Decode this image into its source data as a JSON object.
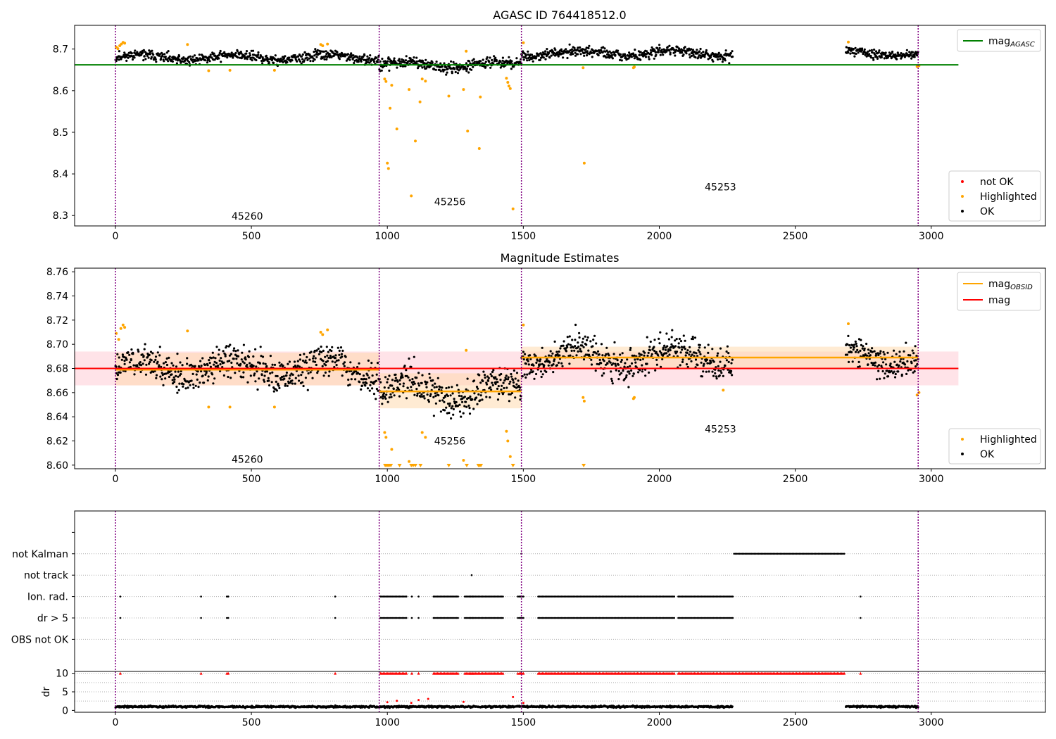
{
  "figure": {
    "background": "#ffffff",
    "obs_boundaries_x": [
      0,
      970,
      1493,
      2952
    ],
    "colors": {
      "ok": "#000000",
      "highlighted": "#ffa500",
      "not_ok": "#ff0000",
      "mag_agasc": "#008000",
      "mag_obsid": "#ffa500",
      "mag": "#ff0000",
      "mag_band": "#ffc0cb",
      "obsid_band": "#ffd8a8",
      "boundary": "#800080",
      "grid": "#b0b0b0"
    }
  },
  "chart_data": [
    {
      "type": "scatter",
      "title": "AGASC ID 764418512.0",
      "xlim": [
        -150,
        3420
      ],
      "ylim": [
        8.275,
        8.757
      ],
      "xticks": [
        0,
        500,
        1000,
        1500,
        2000,
        2500,
        3000
      ],
      "yticks": [
        8.3,
        8.4,
        8.5,
        8.6,
        8.7
      ],
      "ytick_labels": [
        "8.3",
        "8.4",
        "8.5",
        "8.6",
        "8.7"
      ],
      "legend_lines": [
        {
          "label_main": "mag",
          "label_sub": "AGASC",
          "color": "#008000"
        }
      ],
      "legend_points": [
        {
          "label": "not OK",
          "color": "#ff0000"
        },
        {
          "label": "Highlighted",
          "color": "#ffa500"
        },
        {
          "label": "OK",
          "color": "#000000"
        }
      ],
      "hlines": [
        {
          "y": 8.662,
          "x_range": [
            -150,
            3100
          ],
          "color": "#008000"
        }
      ],
      "obs_labels": [
        {
          "text": "45260",
          "x": 485,
          "y": 8.29
        },
        {
          "text": "45256",
          "x": 1230,
          "y": 8.325
        },
        {
          "text": "45253",
          "x": 2225,
          "y": 8.36
        }
      ],
      "ok_segments": [
        {
          "x": [
            0,
            970
          ],
          "level": 8.68,
          "spread": 0.028
        },
        {
          "x": [
            970,
            1493
          ],
          "level": 8.662,
          "spread": 0.03
        },
        {
          "x": [
            1493,
            2270
          ],
          "level": 8.69,
          "spread": 0.028
        },
        {
          "x": [
            2685,
            2952
          ],
          "level": 8.69,
          "spread": 0.026
        }
      ],
      "highlighted_points": [
        [
          3,
          8.705
        ],
        [
          9,
          8.701
        ],
        [
          16,
          8.708
        ],
        [
          22,
          8.712
        ],
        [
          28,
          8.716
        ],
        [
          34,
          8.714
        ],
        [
          265,
          8.711
        ],
        [
          343,
          8.648
        ],
        [
          421,
          8.649
        ],
        [
          585,
          8.649
        ],
        [
          755,
          8.711
        ],
        [
          762,
          8.708
        ],
        [
          780,
          8.712
        ],
        [
          990,
          8.628
        ],
        [
          995,
          8.622
        ],
        [
          1000,
          8.426
        ],
        [
          1004,
          8.413
        ],
        [
          1010,
          8.558
        ],
        [
          1016,
          8.613
        ],
        [
          1035,
          8.508
        ],
        [
          1080,
          8.603
        ],
        [
          1088,
          8.347
        ],
        [
          1103,
          8.479
        ],
        [
          1120,
          8.573
        ],
        [
          1128,
          8.628
        ],
        [
          1140,
          8.623
        ],
        [
          1226,
          8.587
        ],
        [
          1280,
          8.603
        ],
        [
          1290,
          8.695
        ],
        [
          1295,
          8.503
        ],
        [
          1338,
          8.461
        ],
        [
          1342,
          8.585
        ],
        [
          1438,
          8.63
        ],
        [
          1443,
          8.62
        ],
        [
          1447,
          8.611
        ],
        [
          1452,
          8.605
        ],
        [
          1462,
          8.316
        ],
        [
          1500,
          8.715
        ],
        [
          1720,
          8.655
        ],
        [
          1724,
          8.426
        ],
        [
          1905,
          8.655
        ],
        [
          1908,
          8.657
        ],
        [
          2695,
          8.717
        ],
        [
          2948,
          8.658
        ],
        [
          2955,
          8.66
        ]
      ]
    },
    {
      "type": "scatter",
      "title": "Magnitude Estimates",
      "xlim": [
        -150,
        3420
      ],
      "ylim": [
        8.597,
        8.763
      ],
      "xticks": [
        0,
        500,
        1000,
        1500,
        2000,
        2500,
        3000
      ],
      "yticks": [
        8.6,
        8.62,
        8.64,
        8.66,
        8.68,
        8.7,
        8.72,
        8.74,
        8.76
      ],
      "ytick_labels": [
        "8.60",
        "8.62",
        "8.64",
        "8.66",
        "8.68",
        "8.70",
        "8.72",
        "8.74",
        "8.76"
      ],
      "legend_lines": [
        {
          "label_main": "mag",
          "label_sub": "OBSID",
          "color": "#ffa500"
        },
        {
          "label_main": "mag",
          "label_sub": "",
          "color": "#ff0000"
        }
      ],
      "legend_points": [
        {
          "label": "Highlighted",
          "color": "#ffa500"
        },
        {
          "label": "OK",
          "color": "#000000"
        }
      ],
      "mag": {
        "value": 8.68,
        "band": [
          8.666,
          8.694
        ],
        "x_range": [
          -150,
          3100
        ]
      },
      "obsid_mags": [
        {
          "x": [
            0,
            970
          ],
          "value": 8.679,
          "band": [
            8.666,
            8.693
          ]
        },
        {
          "x": [
            970,
            1493
          ],
          "value": 8.661,
          "band": [
            8.647,
            8.676
          ]
        },
        {
          "x": [
            1493,
            2952
          ],
          "value": 8.689,
          "band": [
            8.68,
            8.698
          ]
        }
      ],
      "obs_labels": [
        {
          "text": "45260",
          "x": 485,
          "y": 8.602
        },
        {
          "text": "45256",
          "x": 1230,
          "y": 8.617
        },
        {
          "text": "45253",
          "x": 2225,
          "y": 8.627
        }
      ],
      "ok_segments": [
        {
          "x": [
            0,
            970
          ],
          "level": 8.68,
          "spread": 0.032
        },
        {
          "x": [
            970,
            1493
          ],
          "level": 8.661,
          "spread": 0.034
        },
        {
          "x": [
            1493,
            2270
          ],
          "level": 8.69,
          "spread": 0.032
        },
        {
          "x": [
            2685,
            2952
          ],
          "level": 8.69,
          "spread": 0.03
        }
      ],
      "highlighted_points": [
        [
          3,
          8.709
        ],
        [
          12,
          8.704
        ],
        [
          20,
          8.713
        ],
        [
          28,
          8.716
        ],
        [
          34,
          8.714
        ],
        [
          265,
          8.711
        ],
        [
          343,
          8.648
        ],
        [
          421,
          8.648
        ],
        [
          585,
          8.648
        ],
        [
          755,
          8.71
        ],
        [
          762,
          8.708
        ],
        [
          780,
          8.712
        ],
        [
          990,
          8.627
        ],
        [
          995,
          8.623
        ],
        [
          1016,
          8.613
        ],
        [
          1080,
          8.603
        ],
        [
          1128,
          8.627
        ],
        [
          1140,
          8.623
        ],
        [
          1280,
          8.604
        ],
        [
          1290,
          8.695
        ],
        [
          1438,
          8.628
        ],
        [
          1443,
          8.62
        ],
        [
          1452,
          8.607
        ],
        [
          1500,
          8.716
        ],
        [
          1720,
          8.656
        ],
        [
          1724,
          8.653
        ],
        [
          1905,
          8.655
        ],
        [
          1908,
          8.656
        ],
        [
          2235,
          8.662
        ],
        [
          2695,
          8.717
        ],
        [
          2948,
          8.658
        ],
        [
          2955,
          8.66
        ]
      ],
      "below_range_markers_x": [
        992,
        997,
        1002,
        1007,
        1013,
        1045,
        1088,
        1095,
        1103,
        1122,
        1226,
        1292,
        1335,
        1340,
        1344,
        1462,
        1722
      ]
    },
    {
      "type": "scatter",
      "title": "",
      "xlim": [
        -150,
        3420
      ],
      "ylim": [
        -0.5,
        7
      ],
      "yticks": [
        1,
        2,
        3,
        4,
        5,
        6
      ],
      "ytick_labels": [
        "OBS not OK",
        "dr > 5",
        "Ion. rad.",
        "not track",
        "not Kalman",
        ""
      ],
      "flags": [
        {
          "label": "not Kalman",
          "row": 5,
          "ranges": [
            [
              2275,
              2680
            ]
          ],
          "singles": [
            1493
          ]
        },
        {
          "label": "not track",
          "row": 4,
          "ranges": [],
          "singles": [
            1310
          ]
        },
        {
          "label": "Ion. rad.",
          "row": 3,
          "ranges": [
            [
              975,
              1070
            ],
            [
              1170,
              1260
            ],
            [
              1285,
              1340
            ],
            [
              1345,
              1425
            ],
            [
              1480,
              1500
            ],
            [
              1555,
              2055
            ],
            [
              2070,
              2270
            ]
          ],
          "singles": [
            18,
            315,
            410,
            415,
            808,
            1090,
            1115,
            1305,
            1315,
            2740
          ]
        },
        {
          "label": "dr > 5",
          "row": 2,
          "ranges": [
            [
              975,
              1070
            ],
            [
              1170,
              1260
            ],
            [
              1285,
              1340
            ],
            [
              1345,
              1425
            ],
            [
              1480,
              1500
            ],
            [
              1555,
              2055
            ],
            [
              2070,
              2270
            ]
          ],
          "singles": [
            18,
            315,
            410,
            415,
            808,
            1090,
            1115,
            1305,
            1315,
            2740
          ]
        },
        {
          "label": "OBS not OK",
          "row": 1,
          "ranges": [],
          "singles": []
        }
      ]
    },
    {
      "type": "scatter",
      "title": "",
      "xlim": [
        -150,
        3420
      ],
      "ylim": [
        -0.5,
        10.5
      ],
      "ylabel": "dr",
      "xticks": [
        0,
        500,
        1000,
        1500,
        2000,
        2500,
        3000
      ],
      "yticks": [
        0,
        5,
        10
      ],
      "ytick_labels": [
        "0",
        "5",
        "10"
      ],
      "ok_segments": [
        {
          "x": [
            0,
            970
          ],
          "level": 1.0,
          "spread": 0.55
        },
        {
          "x": [
            970,
            1493
          ],
          "level": 1.0,
          "spread": 0.55
        },
        {
          "x": [
            1493,
            2270
          ],
          "level": 1.0,
          "spread": 0.55
        },
        {
          "x": [
            2685,
            2952
          ],
          "level": 1.0,
          "spread": 0.55
        }
      ],
      "capped_value": 10,
      "capped_ranges": [
        [
          975,
          1070
        ],
        [
          1170,
          1260
        ],
        [
          1285,
          1340
        ],
        [
          1345,
          1425
        ],
        [
          1480,
          1500
        ],
        [
          1555,
          2055
        ],
        [
          2070,
          2680
        ]
      ],
      "capped_singles": [
        18,
        315,
        410,
        415,
        808,
        1090,
        1115,
        1305,
        1315,
        2740
      ],
      "outlier_points": [
        [
          1000,
          2.2
        ],
        [
          1035,
          2.6
        ],
        [
          1088,
          2.0
        ],
        [
          1115,
          2.8
        ],
        [
          1150,
          3.1
        ],
        [
          1280,
          2.3
        ],
        [
          1462,
          3.6
        ],
        [
          1500,
          2.0
        ]
      ]
    }
  ]
}
